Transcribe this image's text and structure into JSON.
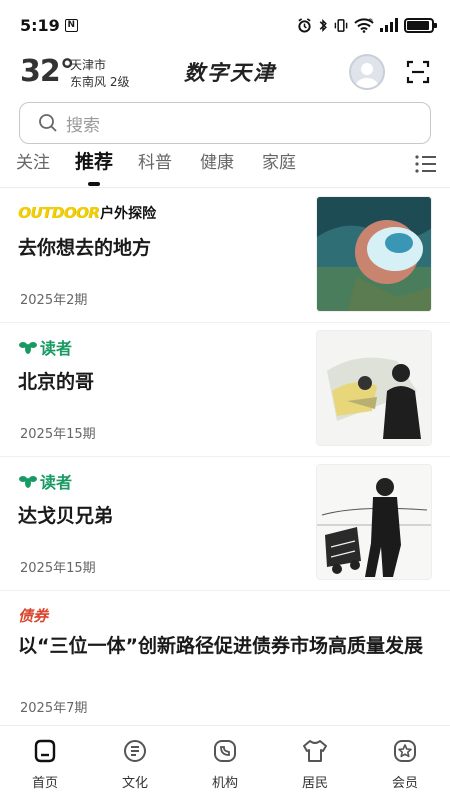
{
  "status_bar": {
    "time": "5:19",
    "n_badge": "N",
    "battery_fraction": 0.9,
    "signal_label": "6"
  },
  "header": {
    "temperature": "32°",
    "city": "天津市",
    "wind": "东南风  2级",
    "app_logo": "数字天津",
    "avatar_icon": "user-avatar-icon",
    "scan_icon": "scan-icon"
  },
  "search": {
    "placeholder": "搜索",
    "icon": "search-icon"
  },
  "tabs": {
    "items": [
      {
        "label": "关注"
      },
      {
        "label": "推荐"
      },
      {
        "label": "科普"
      },
      {
        "label": "健康"
      },
      {
        "label": "家庭"
      }
    ],
    "active_index": 1,
    "menu_icon": "list-menu-icon"
  },
  "feed": {
    "items": [
      {
        "brand_a": "OUTDOOR",
        "brand_b": "户外探险",
        "title": "去你想去的地方",
        "issue": "2025年2期"
      },
      {
        "brand": "读者",
        "title": "北京的哥",
        "issue": "2025年15期"
      },
      {
        "brand": "读者",
        "title": "达戈贝兄弟",
        "issue": "2025年15期"
      },
      {
        "brand": "债券",
        "title": "以“三位一体”创新路径促进债券市场高质量发展",
        "issue": "2025年7期"
      }
    ]
  },
  "bottom_nav": {
    "items": [
      {
        "label": "首页",
        "icon": "home-icon"
      },
      {
        "label": "文化",
        "icon": "book-icon"
      },
      {
        "label": "机构",
        "icon": "phone-icon"
      },
      {
        "label": "居民",
        "icon": "shirt-icon"
      },
      {
        "label": "会员",
        "icon": "star-badge-icon"
      }
    ],
    "active_index": 0
  },
  "colors": {
    "brand_green": "#1a9a63",
    "bond_red": "#d9442b",
    "outdoor_yellow": "#f2cf00"
  }
}
